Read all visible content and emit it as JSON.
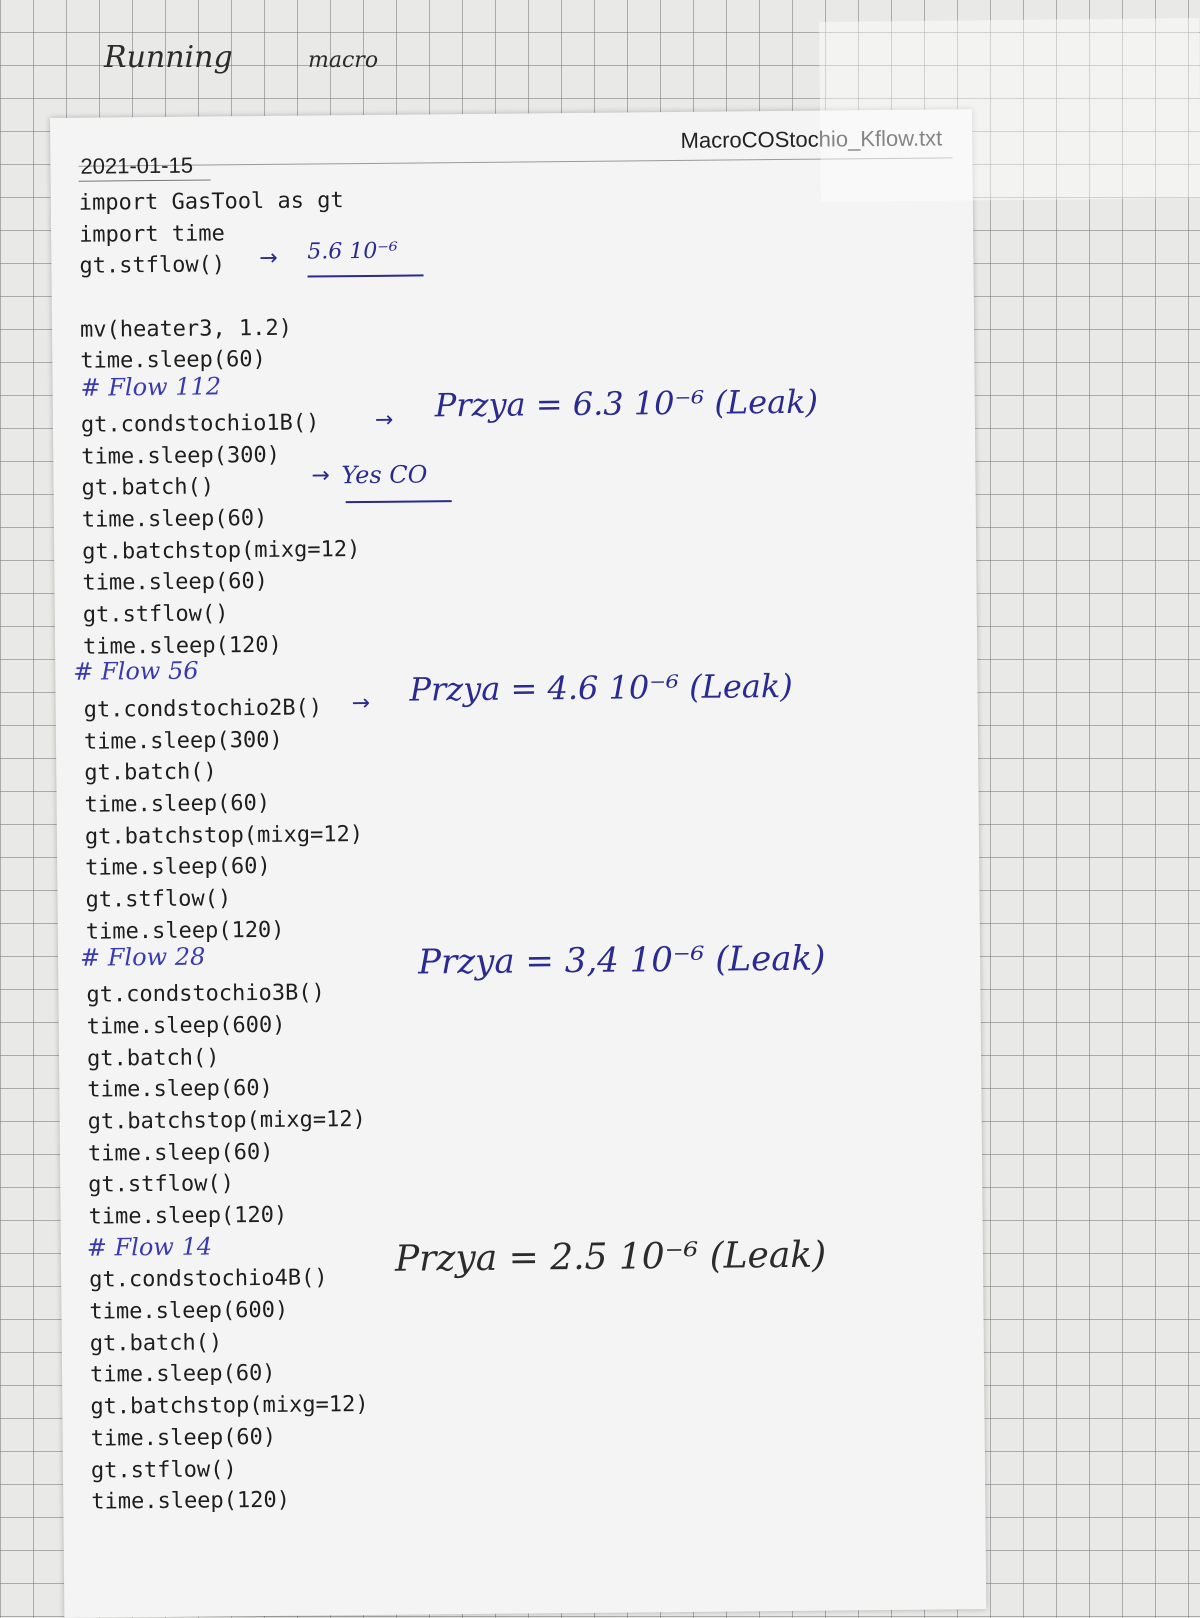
{
  "top_note": {
    "left": "Running",
    "right": "macro"
  },
  "file": {
    "name": "MacroCOStochio_Kflow.txt",
    "date": "2021-01-15"
  },
  "code_lines": [
    "import GasTool as gt",
    "import time",
    "gt.stflow()",
    "",
    "mv(heater3, 1.2)",
    "time.sleep(60)",
    "",
    "gt.condstochio1B()",
    "time.sleep(300)",
    "gt.batch()",
    "time.sleep(60)",
    "gt.batchstop(mixg=12)",
    "time.sleep(60)",
    "gt.stflow()",
    "time.sleep(120)",
    "",
    "gt.condstochio2B()",
    "time.sleep(300)",
    "gt.batch()",
    "time.sleep(60)",
    "gt.batchstop(mixg=12)",
    "time.sleep(60)",
    "gt.stflow()",
    "time.sleep(120)",
    "",
    "gt.condstochio3B()",
    "time.sleep(600)",
    "gt.batch()",
    "time.sleep(60)",
    "gt.batchstop(mixg=12)",
    "time.sleep(60)",
    "gt.stflow()",
    "time.sleep(120)",
    "",
    "gt.condstochio4B()",
    "time.sleep(600)",
    "gt.batch()",
    "time.sleep(60)",
    "gt.batchstop(mixg=12)",
    "time.sleep(60)",
    "gt.stflow()",
    "time.sleep(120)"
  ],
  "annotations": {
    "stflow_value": "5.6 10⁻⁶",
    "flow1_comment": "# Flow 112",
    "flow1_reading": "Przya = 6.3 10⁻⁶ (Leak)",
    "batch_note": "Yes CO",
    "flow2_comment": "# Flow 56",
    "flow2_reading": "Przya = 4.6 10⁻⁶ (Leak)",
    "flow3_comment": "# Flow 28",
    "flow3_reading": "Przya = 3,4 10⁻⁶ (Leak)",
    "flow4_comment": "# Flow 14",
    "flow4_reading": "Przya = 2.5 10⁻⁶ (Leak)"
  },
  "colors": {
    "ink_blue": "#2a2a90",
    "ink_black": "#2b2b2b",
    "paper": "#f4f4f4"
  }
}
